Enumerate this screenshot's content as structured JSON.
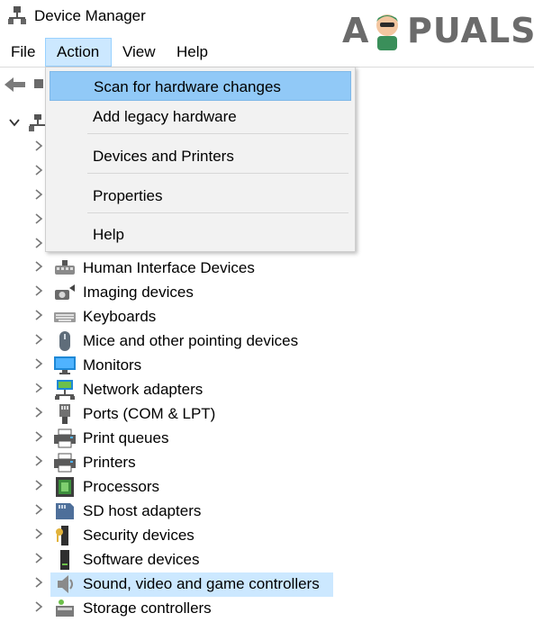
{
  "window": {
    "title": "Device Manager"
  },
  "watermark": {
    "text_left": "A",
    "text_right": "PUALS"
  },
  "menubar": {
    "file": "File",
    "action": "Action",
    "view": "View",
    "help": "Help"
  },
  "action_menu": {
    "items": [
      {
        "label": "Scan for hardware changes",
        "highlighted": true
      },
      {
        "label": "Add legacy hardware"
      },
      {
        "label": "Devices and Printers"
      },
      {
        "label": "Properties"
      },
      {
        "label": "Help"
      }
    ]
  },
  "tree": {
    "items": [
      {
        "label": "Human Interface Devices",
        "icon": "hid-icon"
      },
      {
        "label": "Imaging devices",
        "icon": "camera-icon"
      },
      {
        "label": "Keyboards",
        "icon": "keyboard-icon"
      },
      {
        "label": "Mice and other pointing devices",
        "icon": "mouse-icon"
      },
      {
        "label": "Monitors",
        "icon": "monitor-icon"
      },
      {
        "label": "Network adapters",
        "icon": "network-icon"
      },
      {
        "label": "Ports (COM & LPT)",
        "icon": "port-icon"
      },
      {
        "label": "Print queues",
        "icon": "printer-icon"
      },
      {
        "label": "Printers",
        "icon": "printer-icon"
      },
      {
        "label": "Processors",
        "icon": "processor-icon"
      },
      {
        "label": "SD host adapters",
        "icon": "sd-card-icon"
      },
      {
        "label": "Security devices",
        "icon": "security-key-icon"
      },
      {
        "label": "Software devices",
        "icon": "software-device-icon"
      },
      {
        "label": "Sound, video and game controllers",
        "icon": "speaker-icon",
        "selected": true
      },
      {
        "label": "Storage controllers",
        "icon": "storage-icon"
      }
    ]
  },
  "colors": {
    "selection": "#cce8ff",
    "menu_highlight": "#91c9f7",
    "menu_bg": "#f2f2f2"
  }
}
